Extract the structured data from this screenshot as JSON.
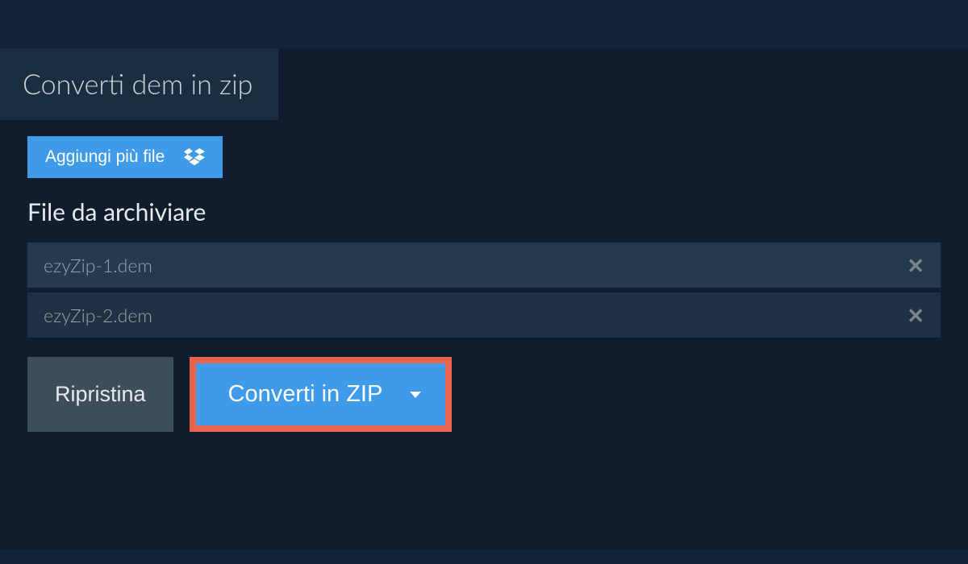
{
  "tab": {
    "title": "Converti dem in zip"
  },
  "addButton": {
    "label": "Aggiungi più file"
  },
  "section": {
    "title": "File da archiviare"
  },
  "files": [
    {
      "name": "ezyZip-1.dem"
    },
    {
      "name": "ezyZip-2.dem"
    }
  ],
  "buttons": {
    "reset": "Ripristina",
    "convert": "Converti in ZIP"
  }
}
